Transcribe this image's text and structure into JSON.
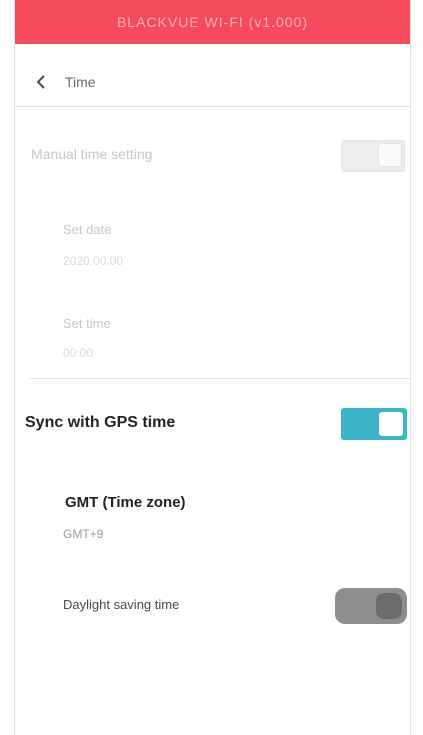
{
  "titlebar": {
    "title": "BLACKVUE WI-FI (v1.000)"
  },
  "navbar": {
    "title": "Time"
  },
  "manual_time_setting": {
    "label": "Manual time setting",
    "toggle_on": false,
    "set_date_label": "Set date",
    "set_date_value": "2020.00.00",
    "set_time_label": "Set time",
    "set_time_value": "00:00"
  },
  "gps_sync": {
    "label": "Sync with GPS time",
    "toggle_on": true
  },
  "gmt": {
    "label": "GMT (Time zone)",
    "value": "GMT+9"
  },
  "daylight": {
    "label": "Daylight saving time",
    "toggle_on": false
  },
  "colors": {
    "titlebar_bg": "#f44a5b",
    "toggle_on": "#3bb5c7",
    "toggle_off": "#ececec"
  }
}
